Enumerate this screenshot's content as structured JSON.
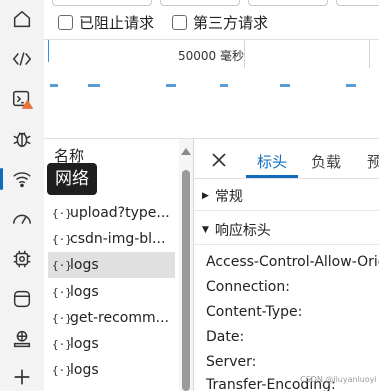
{
  "activity_bar": {
    "items": [
      {
        "name": "home-icon"
      },
      {
        "name": "elements-icon"
      },
      {
        "name": "console-icon"
      },
      {
        "name": "sources-icon"
      },
      {
        "name": "network-icon"
      },
      {
        "name": "performance-icon"
      },
      {
        "name": "memory-icon"
      },
      {
        "name": "application-icon"
      },
      {
        "name": "security-icon"
      },
      {
        "name": "more-tools-icon"
      }
    ],
    "tooltip": "网络"
  },
  "filters": {
    "blocked_requests": "已阻止请求",
    "third_party_requests": "第三方请求"
  },
  "overview": {
    "scale_label": "50000 毫秒"
  },
  "request_list": {
    "header": "名称",
    "rows": [
      {
        "name": "upload?type..."
      },
      {
        "name": "csdn-img-bl..."
      },
      {
        "name": "logs",
        "selected": true
      },
      {
        "name": "logs"
      },
      {
        "name": "get-recomm..."
      },
      {
        "name": "logs"
      },
      {
        "name": "logs"
      }
    ],
    "row_icon": "{·}"
  },
  "details": {
    "tabs": [
      {
        "label": "标头",
        "active": true
      },
      {
        "label": "负载"
      },
      {
        "label": "预"
      }
    ],
    "sections": {
      "general": "常规",
      "response_headers": "响应标头"
    },
    "headers": [
      "Access-Control-Allow-Origi",
      "Connection:",
      "Content-Type:",
      "Date:",
      "Server:",
      "Transfer-Encoding:"
    ]
  },
  "watermark": "CSDN @jiuyanluoyi",
  "colors": {
    "accent": "#0f6cbd",
    "warning_badge": "#e8743b"
  }
}
